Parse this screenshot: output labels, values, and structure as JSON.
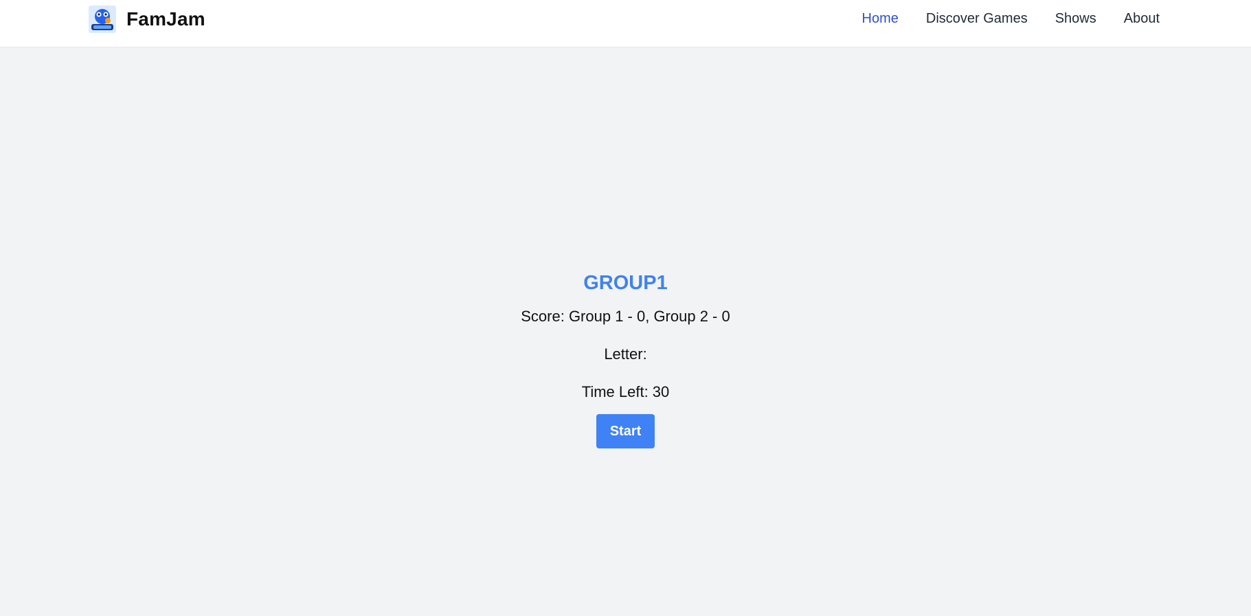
{
  "navbar": {
    "brand": "FamJam",
    "logo_icon": "famjam-logo-icon",
    "links": [
      {
        "label": "Home",
        "active": true
      },
      {
        "label": "Discover Games",
        "active": false
      },
      {
        "label": "Shows",
        "active": false
      },
      {
        "label": "About",
        "active": false
      }
    ]
  },
  "game": {
    "group_title": "GROUP1",
    "score_text": "Score: Group 1 - 0, Group 2 - 0",
    "letter_text": "Letter:",
    "time_text": "Time Left: 30",
    "start_label": "Start"
  },
  "colors": {
    "background": "#f2f3f5",
    "accent": "#3f82ee",
    "active_link": "#2f4fd2",
    "button": "#3f82f5"
  }
}
